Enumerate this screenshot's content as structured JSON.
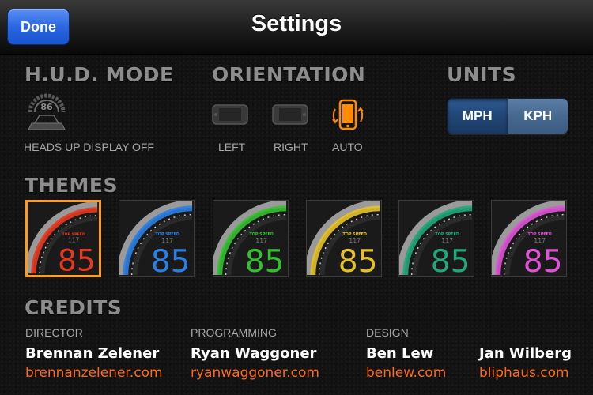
{
  "nav": {
    "done_label": "Done",
    "title": "Settings"
  },
  "hud": {
    "section_title": "H.U.D. MODE",
    "icon_value": "86",
    "status": "HEADS UP DISPLAY OFF"
  },
  "orientation": {
    "section_title": "ORIENTATION",
    "options": [
      {
        "label": "LEFT",
        "icon": "phone-landscape-left-icon",
        "selected": false
      },
      {
        "label": "RIGHT",
        "icon": "phone-landscape-right-icon",
        "selected": false
      },
      {
        "label": "AUTO",
        "icon": "phone-auto-rotate-icon",
        "selected": true
      }
    ],
    "selected_color": "#ff8c00"
  },
  "units": {
    "section_title": "UNITS",
    "options": [
      "MPH",
      "KPH"
    ],
    "selected": "MPH"
  },
  "themes": {
    "section_title": "THEMES",
    "top_speed_label": "TOP SPEED",
    "top_speed_value": "117",
    "speed": "85",
    "items": [
      {
        "color": "#e8391f",
        "selected": true
      },
      {
        "color": "#2a7fe6",
        "selected": false
      },
      {
        "color": "#33c22e",
        "selected": false
      },
      {
        "color": "#e6c228",
        "selected": false
      },
      {
        "color": "#1fa87a",
        "selected": false
      },
      {
        "color": "#e052d6",
        "selected": false
      }
    ],
    "selected_border_color": "#ff9a1a"
  },
  "credits": {
    "section_title": "CREDITS",
    "columns": [
      {
        "role": "DIRECTOR",
        "name": "Brennan Zelener",
        "link": "brennanzelener.com"
      },
      {
        "role": "PROGRAMMING",
        "name": "Ryan Waggoner",
        "link": "ryanwaggoner.com"
      },
      {
        "role": "DESIGN",
        "name": "Ben Lew",
        "link": "benlew.com"
      },
      {
        "role": "",
        "name": "Jan Wilberg",
        "link": "bliphaus.com"
      }
    ],
    "link_color": "#ff6a1a"
  }
}
